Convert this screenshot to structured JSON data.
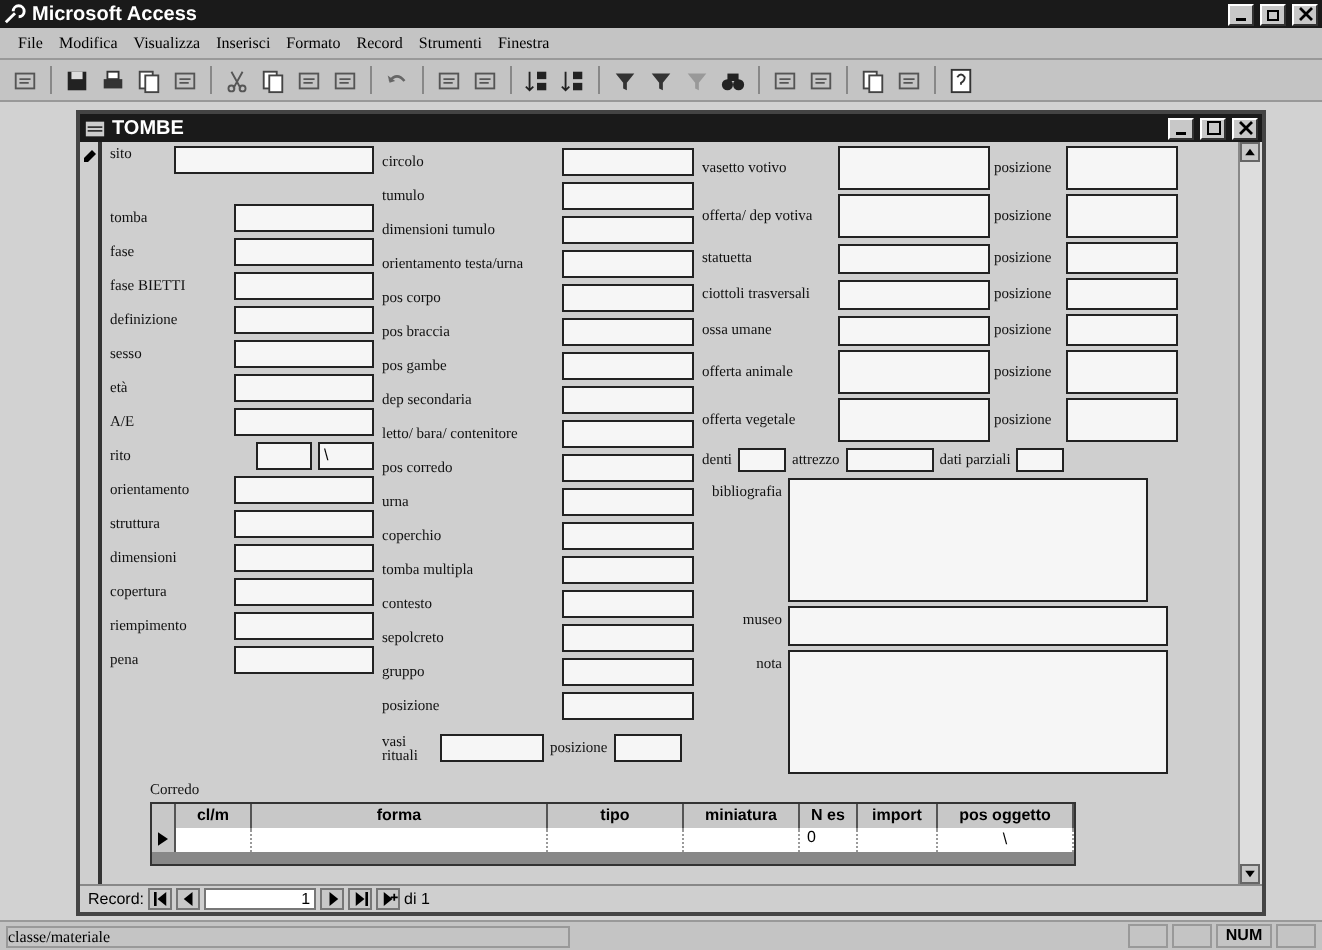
{
  "app": {
    "title": "Microsoft Access"
  },
  "menu": [
    "File",
    "Modifica",
    "Visualizza",
    "Inserisci",
    "Formato",
    "Record",
    "Strumenti",
    "Finestra"
  ],
  "form": {
    "title": "TOMBE",
    "left": [
      {
        "label": "sito",
        "kind": "tall"
      },
      {
        "label": "tomba",
        "kind": "field"
      },
      {
        "label": "fase",
        "kind": "field"
      },
      {
        "label": "fase BIETTI",
        "kind": "field"
      },
      {
        "label": "definizione",
        "kind": "field"
      },
      {
        "label": "sesso",
        "kind": "field"
      },
      {
        "label": "età",
        "kind": "field"
      },
      {
        "label": "A/E",
        "kind": "field"
      },
      {
        "label": "rito",
        "kind": "pair",
        "second_value": "\\"
      },
      {
        "label": "orientamento",
        "kind": "field"
      },
      {
        "label": "struttura",
        "kind": "field"
      },
      {
        "label": "dimensioni",
        "kind": "field"
      },
      {
        "label": "copertura",
        "kind": "field"
      },
      {
        "label": "riempimento",
        "kind": "field"
      },
      {
        "label": "pena",
        "kind": "field"
      }
    ],
    "middle": [
      {
        "label": "circolo"
      },
      {
        "label": "tumulo"
      },
      {
        "label": "dimensioni tumulo"
      },
      {
        "label": "orientamento testa/urna"
      },
      {
        "label": "pos corpo"
      },
      {
        "label": "pos braccia"
      },
      {
        "label": "pos gambe"
      },
      {
        "label": "dep secondaria"
      },
      {
        "label": "letto/ bara/ contenitore"
      },
      {
        "label": "pos corredo"
      },
      {
        "label": "urna"
      },
      {
        "label": "coperchio"
      },
      {
        "label": "tomba multipla"
      },
      {
        "label": "contesto"
      },
      {
        "label": "sepolcreto"
      },
      {
        "label": "gruppo"
      },
      {
        "label": "posizione"
      }
    ],
    "vasi": {
      "label": "vasi rituali",
      "pos_label": "posizione"
    },
    "right": [
      {
        "label": "vasetto votivo",
        "pos_label": "posizione",
        "kind": "tall"
      },
      {
        "label": "offerta/ dep votiva",
        "pos_label": "posizione",
        "kind": "tall"
      },
      {
        "label": "statuetta",
        "pos_label": "posizione",
        "kind": "short"
      },
      {
        "label": "ciottoli trasversali",
        "pos_label": "posizione",
        "kind": "short"
      },
      {
        "label": "ossa umane",
        "pos_label": "posizione",
        "kind": "short"
      },
      {
        "label": "offerta animale",
        "pos_label": "posizione",
        "kind": "tall"
      },
      {
        "label": "offerta vegetale",
        "pos_label": "posizione",
        "kind": "tall"
      }
    ],
    "denti": {
      "label": "denti",
      "label_2": "attrezzo",
      "label_3": "dati parziali"
    },
    "bibliografia": "bibliografia",
    "museo": "museo",
    "nota": "nota",
    "subform": {
      "title": "Corredo",
      "columns": [
        "cl/m",
        "forma",
        "tipo",
        "miniatura",
        "N es",
        "import",
        "pos oggetto"
      ],
      "row": {
        "n_es": "0",
        "pos_oggetto": "\\"
      }
    },
    "nav": {
      "label": "Record:",
      "current": "1",
      "total": "di 1"
    }
  },
  "status_bar": {
    "text": "classe/materiale",
    "indicator": "NUM"
  }
}
